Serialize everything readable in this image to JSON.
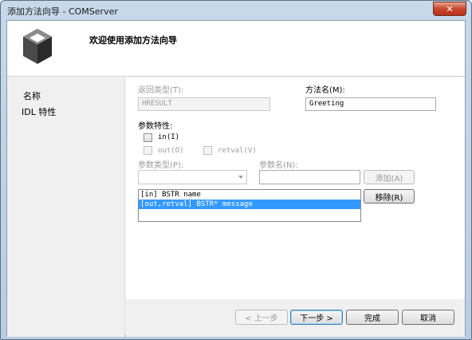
{
  "window": {
    "title": "添加方法向导 - COMServer",
    "close_label": "✕"
  },
  "header": {
    "icon": "box-cube-icon",
    "title": "欢迎使用添加方法向导"
  },
  "sidebar": {
    "items": [
      {
        "label": "名称"
      },
      {
        "label": "IDL 特性"
      }
    ]
  },
  "form": {
    "return_type_label": "返回类型(T):",
    "return_type_value": "HRESULT",
    "method_name_label": "方法名(M):",
    "method_name_value": "Greeting",
    "param_attrs_label": "参数特性:",
    "in_label": "in(I)",
    "out_label": "out(O)",
    "retval_label": "retval(V)",
    "param_type_label": "参数类型(P):",
    "param_type_value": "",
    "param_name_label": "参数名(N):",
    "param_name_value": "",
    "add_button": "添加(A)",
    "remove_button": "移除(R)",
    "params": [
      {
        "text": "[in] BSTR name",
        "selected": false
      },
      {
        "text": "[out,retval] BSTR* message",
        "selected": true
      }
    ]
  },
  "footer": {
    "back_button": "< 上一步",
    "next_button": "下一步 >",
    "finish_button": "完成",
    "cancel_button": "取消"
  },
  "colors": {
    "selection": "#3399ff",
    "close_button": "#c9472b"
  }
}
